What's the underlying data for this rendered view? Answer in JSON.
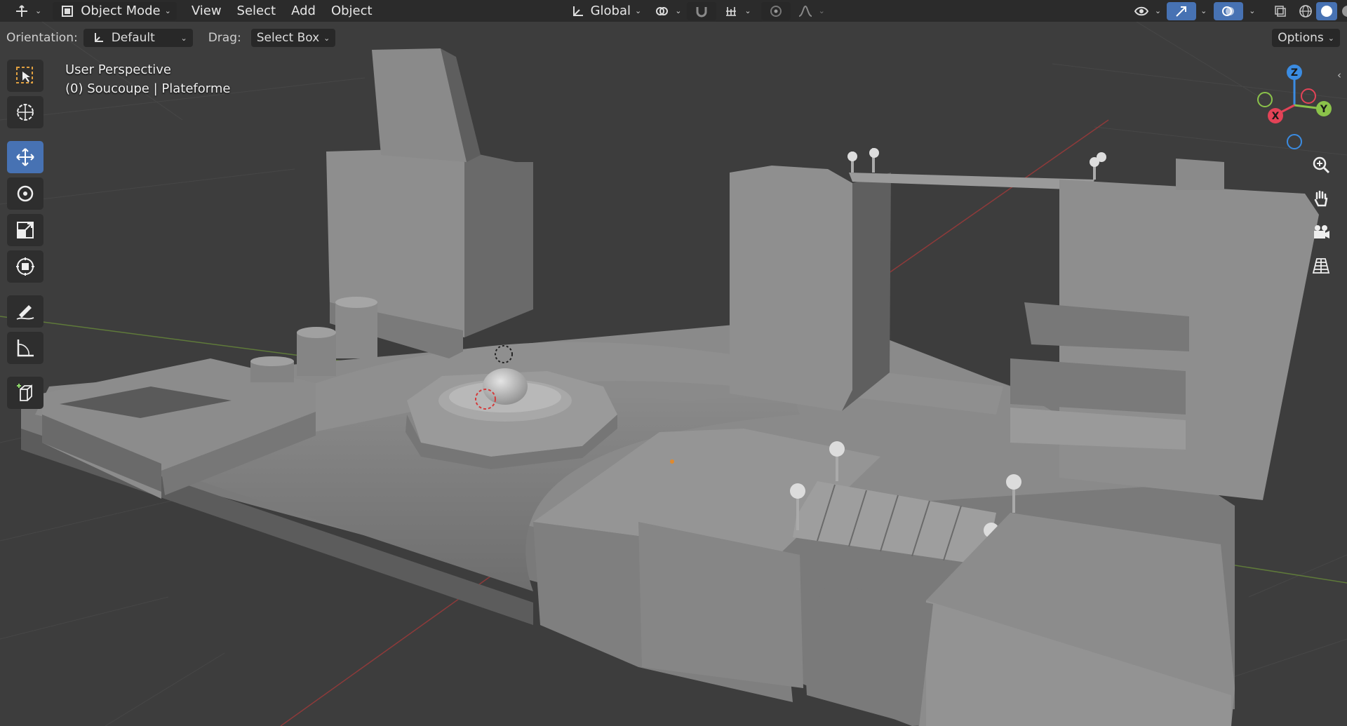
{
  "topbar": {
    "editor_type_icon": "transform-editor-icon",
    "mode": "Object Mode",
    "menus": [
      "View",
      "Select",
      "Add",
      "Object"
    ],
    "transform_orientation": "Global",
    "icons": {
      "pivot": "pivot-point-icon",
      "snap": "magnet-snap-icon",
      "snap_target": "snap-increment-icon",
      "proportional": "proportional-edit-icon",
      "falloff": "falloff-curve-icon",
      "visibility": "visibility-eye-icon",
      "gizmo": "gizmo-toggle-icon",
      "overlays": "overlays-icon",
      "xray": "xray-icon",
      "shading": [
        "wireframe-shading-icon",
        "solid-shading-icon",
        "material-shading-icon",
        "rendered-shading-icon"
      ]
    }
  },
  "headerbar": {
    "orientation_label": "Orientation:",
    "orientation_value": "Default",
    "drag_label": "Drag:",
    "drag_value": "Select Box",
    "options_label": "Options"
  },
  "viewport": {
    "perspective": "User Perspective",
    "context": "(0) Soucoupe | Plateforme"
  },
  "toolbar": {
    "tools": [
      "select-box-icon",
      "cursor-icon",
      "move-icon",
      "rotate-icon",
      "scale-icon",
      "transform-icon",
      "annotate-icon",
      "measure-icon",
      "add-cube-icon"
    ],
    "active": "move-icon"
  },
  "gizmo": {
    "axes": [
      "Z",
      "X",
      "Y"
    ],
    "colors": {
      "x": "#e34357",
      "y": "#8bc34a",
      "z": "#3b8ce2"
    }
  },
  "nav": [
    "zoom-icon",
    "pan-hand-icon",
    "camera-icon",
    "ortho-grid-icon"
  ],
  "colors": {
    "accent": "#4772b3",
    "bg": "#3d3d3d",
    "header": "#2b2b2b"
  }
}
